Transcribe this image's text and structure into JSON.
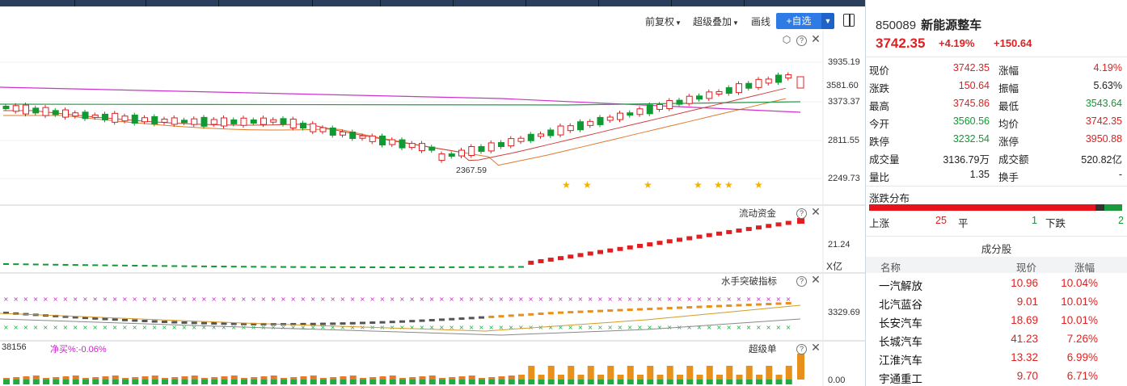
{
  "toolbar": {
    "restore_label": "前复权",
    "overlay_label": "超级叠加",
    "draw_label": "画线",
    "add_label": "+自选"
  },
  "main_chart": {
    "price_labels": [
      "3935.19",
      "3373.37",
      "2811.55",
      "2249.73"
    ],
    "current_price_label": "3581.60",
    "low_label": "2367.59",
    "star_glyph": "★"
  },
  "fund_flow": {
    "title": "流动资金",
    "value_label": "21.24",
    "unit_label": "X亿"
  },
  "sailor": {
    "title": "水手突破指标",
    "value_label": "3329.69"
  },
  "super_order": {
    "title": "超级单",
    "left_value": "38156",
    "net_buy_label": "净买%:-0.06%",
    "value_label": "0.00"
  },
  "stock": {
    "code": "850089",
    "name": "新能源整车",
    "price": "3742.35",
    "change_pct": "+4.19%",
    "change_amt": "+150.64"
  },
  "quote_rows": [
    {
      "l1": "现价",
      "v1": "3742.35",
      "c1": "red",
      "l2": "涨幅",
      "v2": "4.19%",
      "c2": "red"
    },
    {
      "l1": "涨跌",
      "v1": "150.64",
      "c1": "red",
      "l2": "振幅",
      "v2": "5.63%",
      "c2": "dark"
    },
    {
      "l1": "最高",
      "v1": "3745.86",
      "c1": "red",
      "l2": "最低",
      "v2": "3543.64",
      "c2": "green"
    },
    {
      "l1": "今开",
      "v1": "3560.56",
      "c1": "green",
      "l2": "均价",
      "v2": "3742.35",
      "c2": "red"
    },
    {
      "l1": "跌停",
      "v1": "3232.54",
      "c1": "green",
      "l2": "涨停",
      "v2": "3950.88",
      "c2": "red"
    },
    {
      "l1": "成交量",
      "v1": "3136.79万",
      "c1": "dark",
      "l2": "成交额",
      "v2": "520.82亿",
      "c2": "dark"
    },
    {
      "l1": "量比",
      "v1": "1.35",
      "c1": "dark",
      "l2": "换手",
      "v2": "-",
      "c2": "dark"
    }
  ],
  "distribution": {
    "title": "涨跌分布",
    "up_label": "上涨",
    "up_count": "25",
    "flat_label": "平",
    "flat_count": "1",
    "down_label": "下跌",
    "down_count": "2",
    "bar_fractions": {
      "up": 0.893,
      "flat": 0.036,
      "down": 0.071
    }
  },
  "components": {
    "title": "成分股",
    "headers": {
      "name": "名称",
      "price": "现价",
      "pct": "涨幅"
    },
    "rows": [
      {
        "name": "一汽解放",
        "price": "10.96",
        "pct": "10.04%"
      },
      {
        "name": "北汽蓝谷",
        "price": "9.01",
        "pct": "10.01%"
      },
      {
        "name": "长安汽车",
        "price": "18.69",
        "pct": "10.01%"
      },
      {
        "name": "长城汽车",
        "price": "41.23",
        "pct": "7.26%"
      },
      {
        "name": "江淮汽车",
        "price": "13.32",
        "pct": "6.99%"
      },
      {
        "name": "宇通重工",
        "price": "9.70",
        "pct": "6.71%"
      }
    ]
  },
  "colors": {
    "up": "#e02020",
    "down": "#119933",
    "accent": "#2f7be5"
  }
}
